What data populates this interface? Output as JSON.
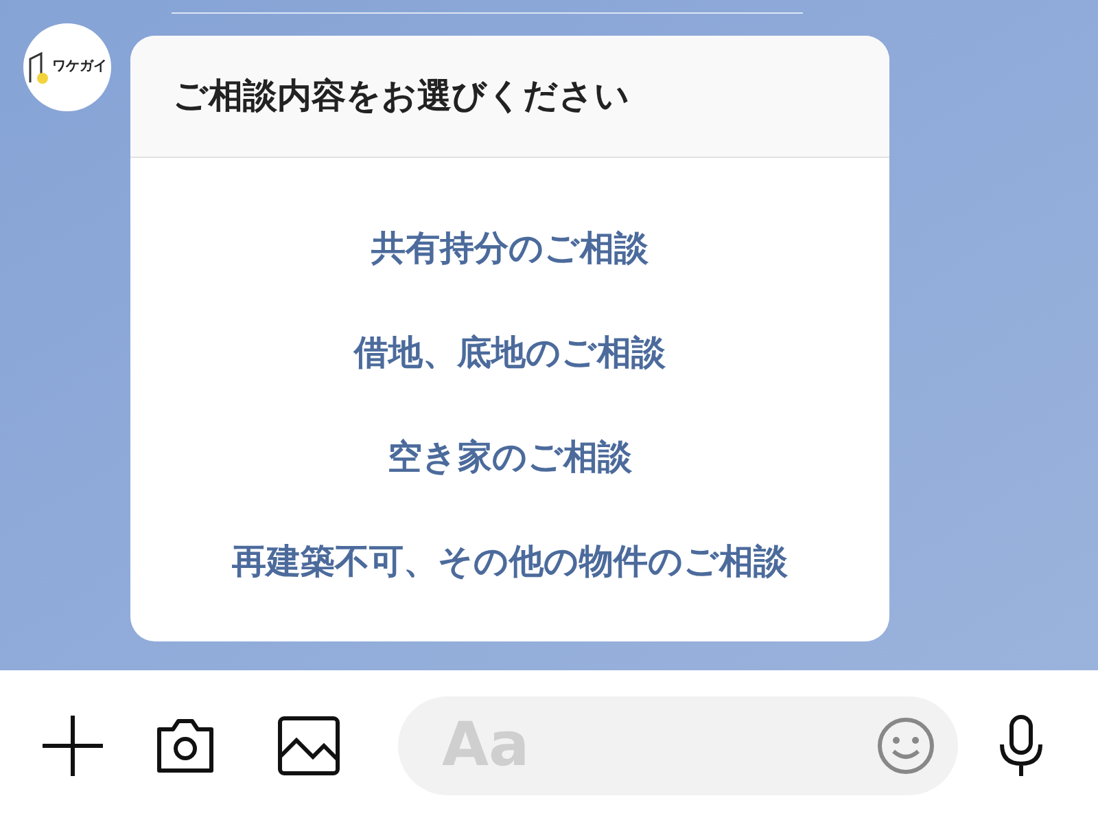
{
  "avatar": {
    "logo_text": "ワケガイ"
  },
  "card": {
    "title": "ご相談内容をお選びください",
    "options": [
      {
        "label": "共有持分のご相談"
      },
      {
        "label": "借地、底地のご相談"
      },
      {
        "label": "空き家のご相談"
      },
      {
        "label": "再建築不可、その他の物件のご相談"
      }
    ]
  },
  "input_bar": {
    "placeholder": "Aa"
  }
}
